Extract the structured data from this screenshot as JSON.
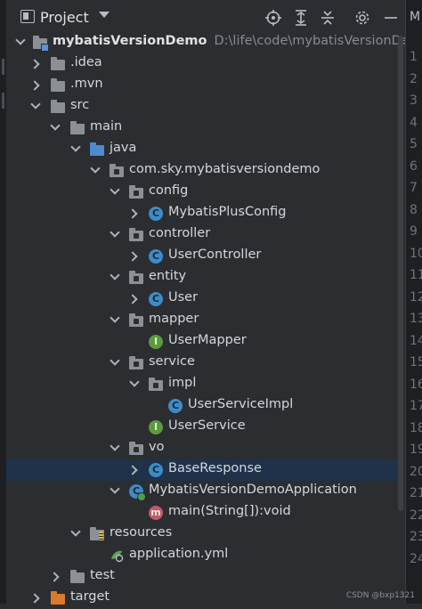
{
  "header": {
    "title": "Project",
    "icons": [
      "locate-icon",
      "expand-all-icon",
      "collapse-all-icon",
      "settings-icon",
      "hide-icon"
    ]
  },
  "tree": [
    {
      "label": "mybatisVersionDemo",
      "path": "D:\\life\\code\\mybatisVersionDemo",
      "icon": "module-folder-icon",
      "expanded": true,
      "bold": true
    },
    {
      "label": ".idea",
      "icon": "folder-icon",
      "expanded": false
    },
    {
      "label": ".mvn",
      "icon": "folder-icon",
      "expanded": false
    },
    {
      "label": "src",
      "icon": "folder-icon",
      "expanded": true
    },
    {
      "label": "main",
      "icon": "folder-icon",
      "expanded": true
    },
    {
      "label": "java",
      "icon": "source-folder-icon",
      "expanded": true
    },
    {
      "label": "com.sky.mybatisversiondemo",
      "icon": "package-icon",
      "expanded": true
    },
    {
      "label": "config",
      "icon": "package-icon",
      "expanded": true
    },
    {
      "label": "MybatisPlusConfig",
      "icon": "class-icon",
      "expanded": false
    },
    {
      "label": "controller",
      "icon": "package-icon",
      "expanded": true
    },
    {
      "label": "UserController",
      "icon": "class-icon",
      "expanded": false
    },
    {
      "label": "entity",
      "icon": "package-icon",
      "expanded": true
    },
    {
      "label": "User",
      "icon": "class-icon",
      "expanded": false
    },
    {
      "label": "mapper",
      "icon": "package-icon",
      "expanded": true
    },
    {
      "label": "UserMapper",
      "icon": "interface-icon"
    },
    {
      "label": "service",
      "icon": "package-icon",
      "expanded": true
    },
    {
      "label": "impl",
      "icon": "package-icon",
      "expanded": true
    },
    {
      "label": "UserServiceImpl",
      "icon": "class-icon"
    },
    {
      "label": "UserService",
      "icon": "interface-icon"
    },
    {
      "label": "vo",
      "icon": "package-icon",
      "expanded": true
    },
    {
      "label": "BaseResponse",
      "icon": "class-icon",
      "expanded": false,
      "selected": true
    },
    {
      "label": "MybatisVersionDemoApplication",
      "icon": "spring-app-icon",
      "expanded": true
    },
    {
      "label": "main(String[]):void",
      "icon": "method-icon"
    },
    {
      "label": "resources",
      "icon": "resources-folder-icon",
      "expanded": true
    },
    {
      "label": "application.yml",
      "icon": "yaml-icon"
    },
    {
      "label": "test",
      "icon": "folder-icon",
      "expanded": false
    },
    {
      "label": "target",
      "icon": "excluded-folder-icon",
      "expanded": false
    }
  ],
  "gutter": {
    "top_letter": "M",
    "line_numbers": [
      "1",
      "2",
      "3",
      "4",
      "5",
      "6",
      "7",
      "8",
      "9",
      "10",
      "11",
      "12",
      "13",
      "14",
      "15",
      "16",
      "17",
      "18",
      "19",
      "20",
      "21",
      "22",
      "23",
      "24"
    ]
  },
  "watermark": "CSDN @bxp1321",
  "colors": {
    "background": "#2b2d30",
    "selection": "#1f3249",
    "class_icon": "#3e8bc9",
    "interface_icon": "#5b9b3e",
    "method_icon": "#c05a6a",
    "source_folder": "#4f8ad1",
    "excluded_folder": "#d97a2e"
  }
}
